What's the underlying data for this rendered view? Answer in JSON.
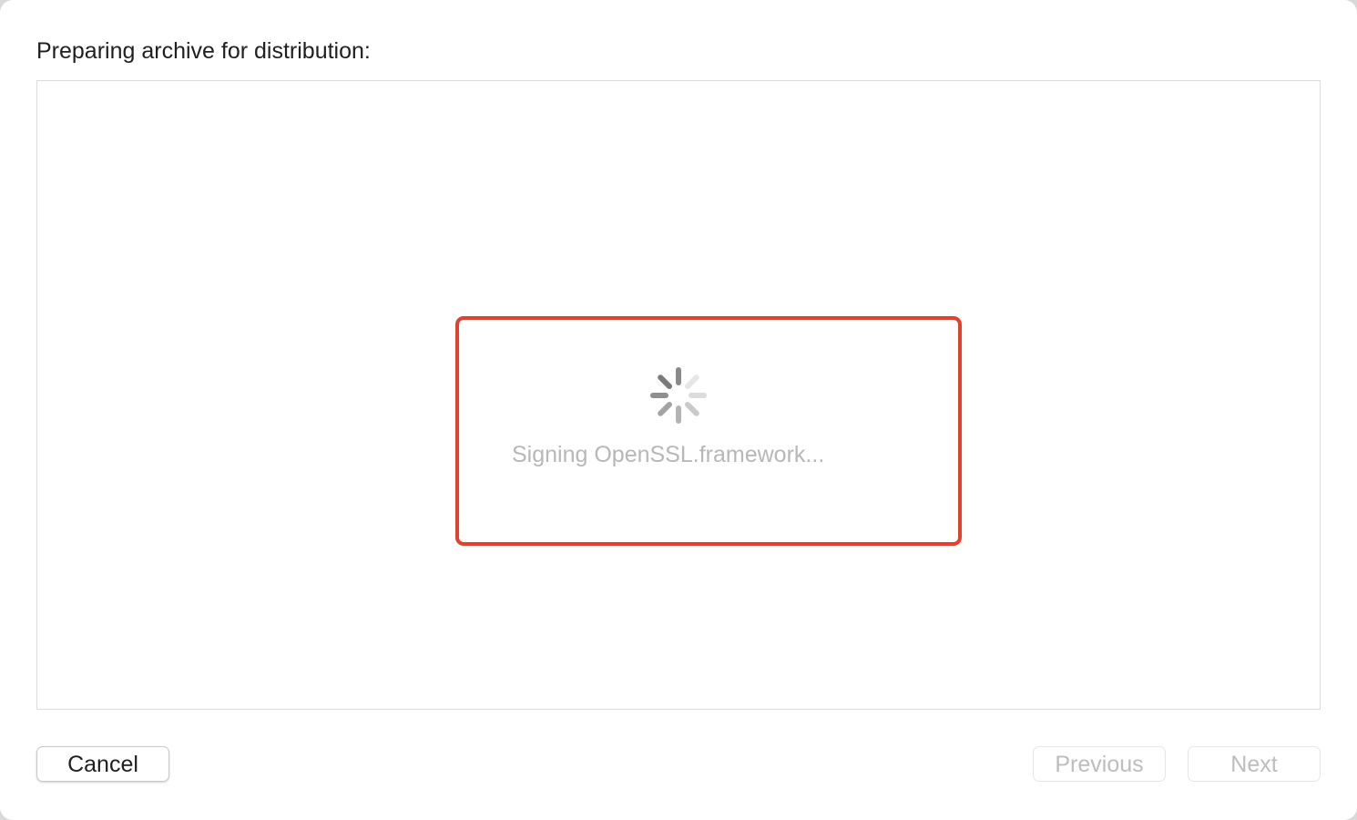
{
  "dialog": {
    "title": "Preparing archive for distribution:",
    "status_text": "Signing OpenSSL.framework...",
    "spinner_icon": "activity-spinner-icon",
    "highlight_color": "#e4412b"
  },
  "buttons": {
    "cancel_label": "Cancel",
    "previous_label": "Previous",
    "next_label": "Next"
  }
}
